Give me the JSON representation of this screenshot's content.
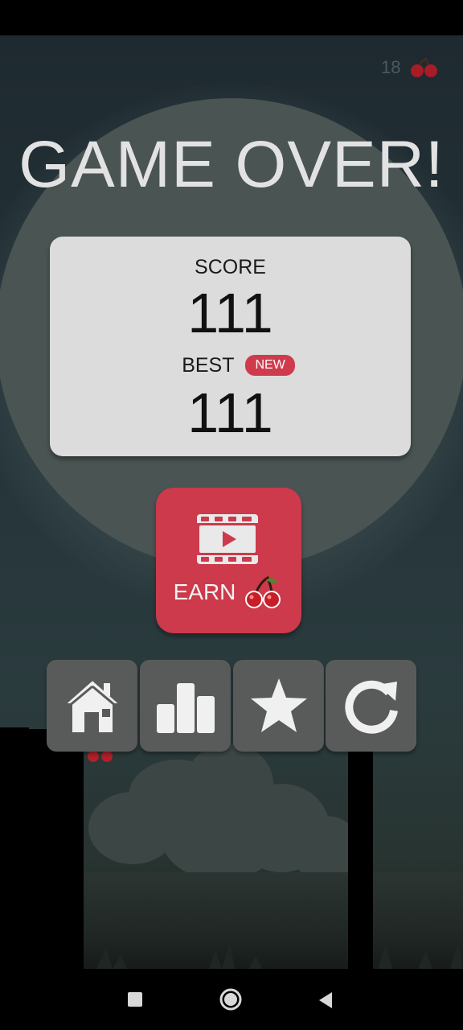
{
  "hud": {
    "cherry_count": "18"
  },
  "title": "GAME OVER!",
  "score_card": {
    "score_label": "SCORE",
    "score_value": "111",
    "best_label": "BEST",
    "new_badge": "NEW",
    "best_value": "111"
  },
  "earn_button": {
    "label": "EARN",
    "icons": [
      "film-play-icon",
      "cherries-icon"
    ]
  },
  "menu_buttons": [
    "home-icon",
    "leaderboard-icon",
    "star-icon",
    "restart-icon"
  ],
  "nav_bar": [
    "recents-square-icon",
    "home-circle-icon",
    "back-triangle-icon"
  ],
  "colors": {
    "accent_red": "#cc3a4c",
    "card_bg": "#dcdcdc",
    "button_gray": "#595b5a",
    "title_text": "#e2e2e2"
  }
}
